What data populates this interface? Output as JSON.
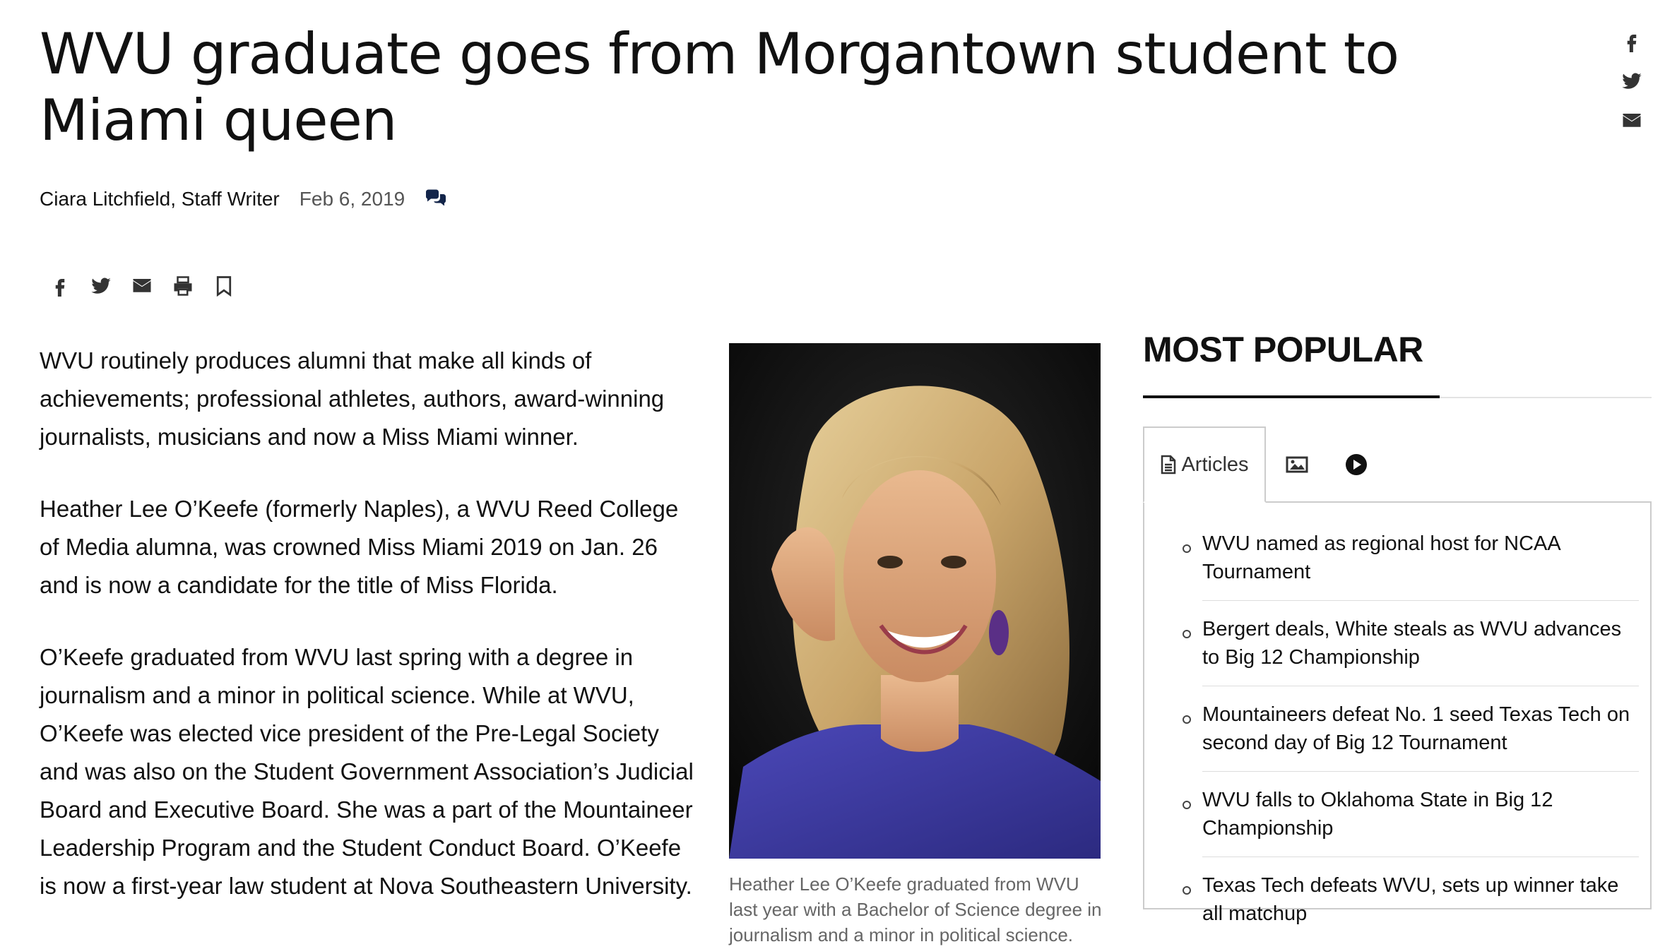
{
  "article": {
    "title": "WVU graduate goes from Morgantown student to Miami queen",
    "author": "Ciara Litchfield, Staff Writer",
    "date": "Feb 6, 2019",
    "paragraphs": [
      "WVU routinely produces alumni that make all kinds of achievements; professional athletes, authors, award-winning journalists, musicians and now a Miss Miami winner.",
      "Heather Lee O’Keefe (formerly Naples), a WVU Reed College of Media alumna, was crowned Miss Miami 2019 on Jan. 26 and is now a candidate for the title of Miss Florida.",
      "O’Keefe graduated from WVU last spring with a degree in journalism and a minor in political science. While at WVU, O’Keefe was elected vice president of the Pre-Legal Society and was also on the Student Government Association’s Judicial Board and Executive Board. She was a part of the Mountaineer Leadership Program and the Student Conduct Board. O’Keefe is now a first-year law student at Nova Southeastern University."
    ],
    "photo_caption": "Heather Lee O’Keefe graduated from WVU last year with a Bachelor of Science degree in journalism and a minor in political science."
  },
  "share_icons": [
    "facebook-icon",
    "twitter-icon",
    "email-icon",
    "print-icon",
    "bookmark-icon"
  ],
  "side_share_icons": [
    "facebook-icon",
    "twitter-icon",
    "email-icon"
  ],
  "most_popular": {
    "title": "MOST POPULAR",
    "tabs": {
      "articles_label": "Articles",
      "photos_icon": "image-icon",
      "videos_icon": "play-icon"
    },
    "items": [
      "WVU named as regional host for NCAA Tournament",
      "Bergert deals, White steals as WVU advances to Big 12 Championship",
      "Mountaineers defeat No. 1 seed Texas Tech on second day of Big 12 Tournament",
      "WVU falls to Oklahoma State in Big 12 Championship",
      "Texas Tech defeats WVU, sets up winner take all matchup"
    ]
  },
  "colors": {
    "comment_icon": "#13254a",
    "text": "#111111",
    "muted": "#666666",
    "tab_border": "#cccccc"
  }
}
